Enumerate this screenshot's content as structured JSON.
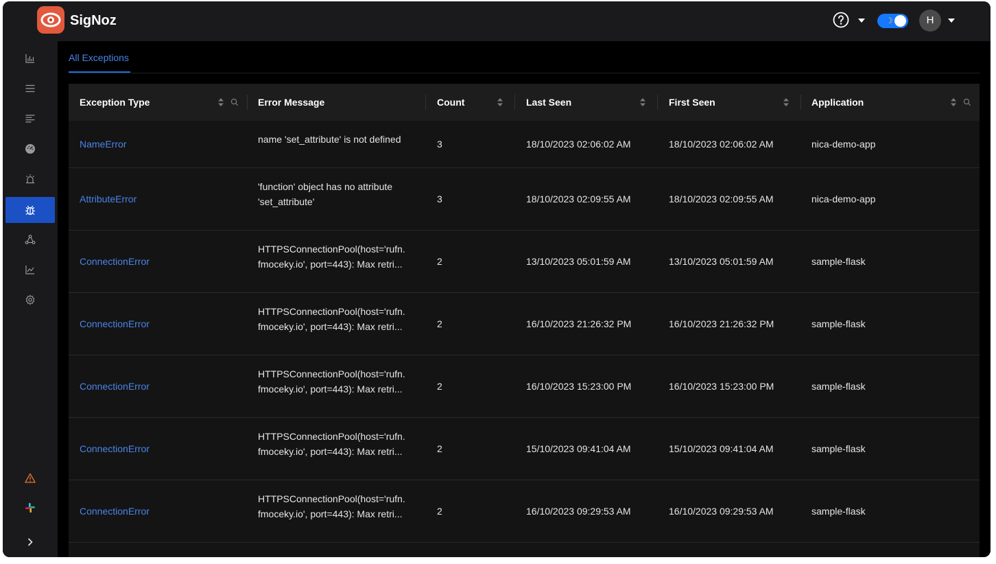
{
  "brand": {
    "name": "SigNoz"
  },
  "header": {
    "avatar_initial": "H"
  },
  "main": {
    "tab_label": "All Exceptions"
  },
  "table": {
    "columns": [
      "Exception Type",
      "Error Message",
      "Count",
      "Last Seen",
      "First Seen",
      "Application"
    ],
    "rows": [
      {
        "type": "NameError",
        "message": [
          "name 'set_attribute' is not defined"
        ],
        "count": "3",
        "last_seen": "18/10/2023 02:06:02 AM",
        "first_seen": "18/10/2023 02:06:02 AM",
        "application": "nica-demo-app"
      },
      {
        "type": "AttributeError",
        "message": [
          "'function' object has no attribute",
          "'set_attribute'"
        ],
        "count": "3",
        "last_seen": "18/10/2023 02:09:55 AM",
        "first_seen": "18/10/2023 02:09:55 AM",
        "application": "nica-demo-app"
      },
      {
        "type": "ConnectionError",
        "message": [
          "HTTPSConnectionPool(host='rufn.",
          "fmoceky.io', port=443): Max retri..."
        ],
        "count": "2",
        "last_seen": "13/10/2023 05:01:59 AM",
        "first_seen": "13/10/2023 05:01:59 AM",
        "application": "sample-flask"
      },
      {
        "type": "ConnectionError",
        "message": [
          "HTTPSConnectionPool(host='rufn.",
          "fmoceky.io', port=443): Max retri..."
        ],
        "count": "2",
        "last_seen": "16/10/2023 21:26:32 PM",
        "first_seen": "16/10/2023 21:26:32 PM",
        "application": "sample-flask"
      },
      {
        "type": "ConnectionError",
        "message": [
          "HTTPSConnectionPool(host='rufn.",
          "fmoceky.io', port=443): Max retri..."
        ],
        "count": "2",
        "last_seen": "16/10/2023 15:23:00 PM",
        "first_seen": "16/10/2023 15:23:00 PM",
        "application": "sample-flask"
      },
      {
        "type": "ConnectionError",
        "message": [
          "HTTPSConnectionPool(host='rufn.",
          "fmoceky.io', port=443): Max retri..."
        ],
        "count": "2",
        "last_seen": "15/10/2023 09:41:04 AM",
        "first_seen": "15/10/2023 09:41:04 AM",
        "application": "sample-flask"
      },
      {
        "type": "ConnectionError",
        "message": [
          "HTTPSConnectionPool(host='rufn.",
          "fmoceky.io', port=443): Max retri..."
        ],
        "count": "2",
        "last_seen": "16/10/2023 09:29:53 AM",
        "first_seen": "16/10/2023 09:29:53 AM",
        "application": "sample-flask"
      }
    ]
  },
  "colors": {
    "accent": "#1b51c5",
    "link": "#4a84e8",
    "logo": "#e2593e",
    "warning": "#e8742c"
  },
  "icons": {
    "sidebar": [
      "bar-chart-icon",
      "list-icon",
      "logs-icon",
      "dashboard-icon",
      "alarm-icon",
      "bug-icon",
      "service-map-icon",
      "line-chart-icon",
      "settings-icon",
      "warning-icon",
      "slack-icon",
      "expand-icon"
    ],
    "header": [
      "help-icon",
      "moon-icon"
    ]
  }
}
